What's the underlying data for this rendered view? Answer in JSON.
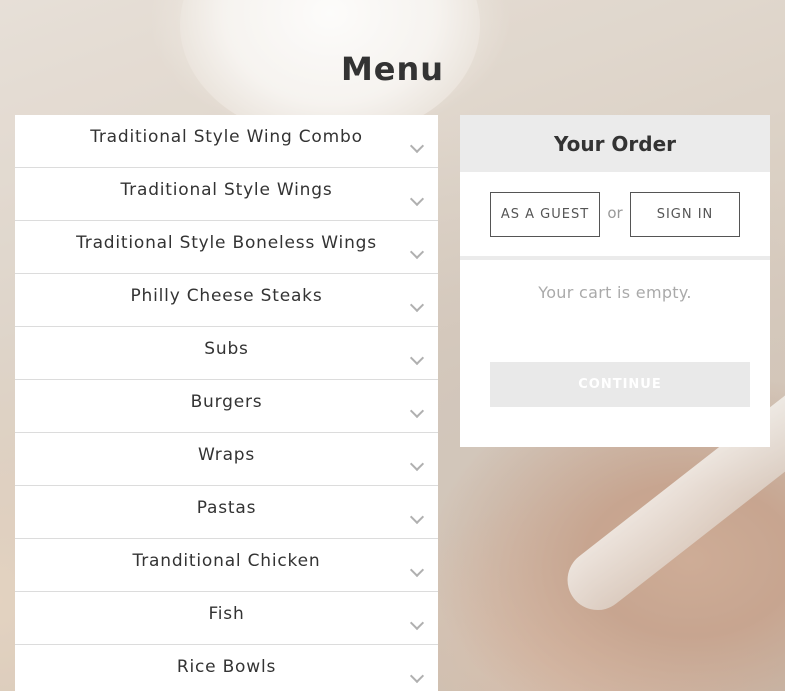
{
  "page_title": "Menu",
  "menu": {
    "categories": [
      {
        "label": "Traditional Style Wing Combo"
      },
      {
        "label": "Traditional Style Wings"
      },
      {
        "label": "Traditional Style Boneless Wings"
      },
      {
        "label": "Philly Cheese Steaks"
      },
      {
        "label": "Subs"
      },
      {
        "label": "Burgers"
      },
      {
        "label": "Wraps"
      },
      {
        "label": "Pastas"
      },
      {
        "label": "Tranditional Chicken"
      },
      {
        "label": "Fish"
      },
      {
        "label": "Rice Bowls"
      }
    ],
    "expand_icon": "chevron-down-icon"
  },
  "order": {
    "title": "Your Order",
    "guest_label": "AS A GUEST",
    "or_label": "or",
    "signin_label": "SIGN IN",
    "cart_empty_text": "Your cart is empty.",
    "continue_label": "CONTINUE"
  }
}
